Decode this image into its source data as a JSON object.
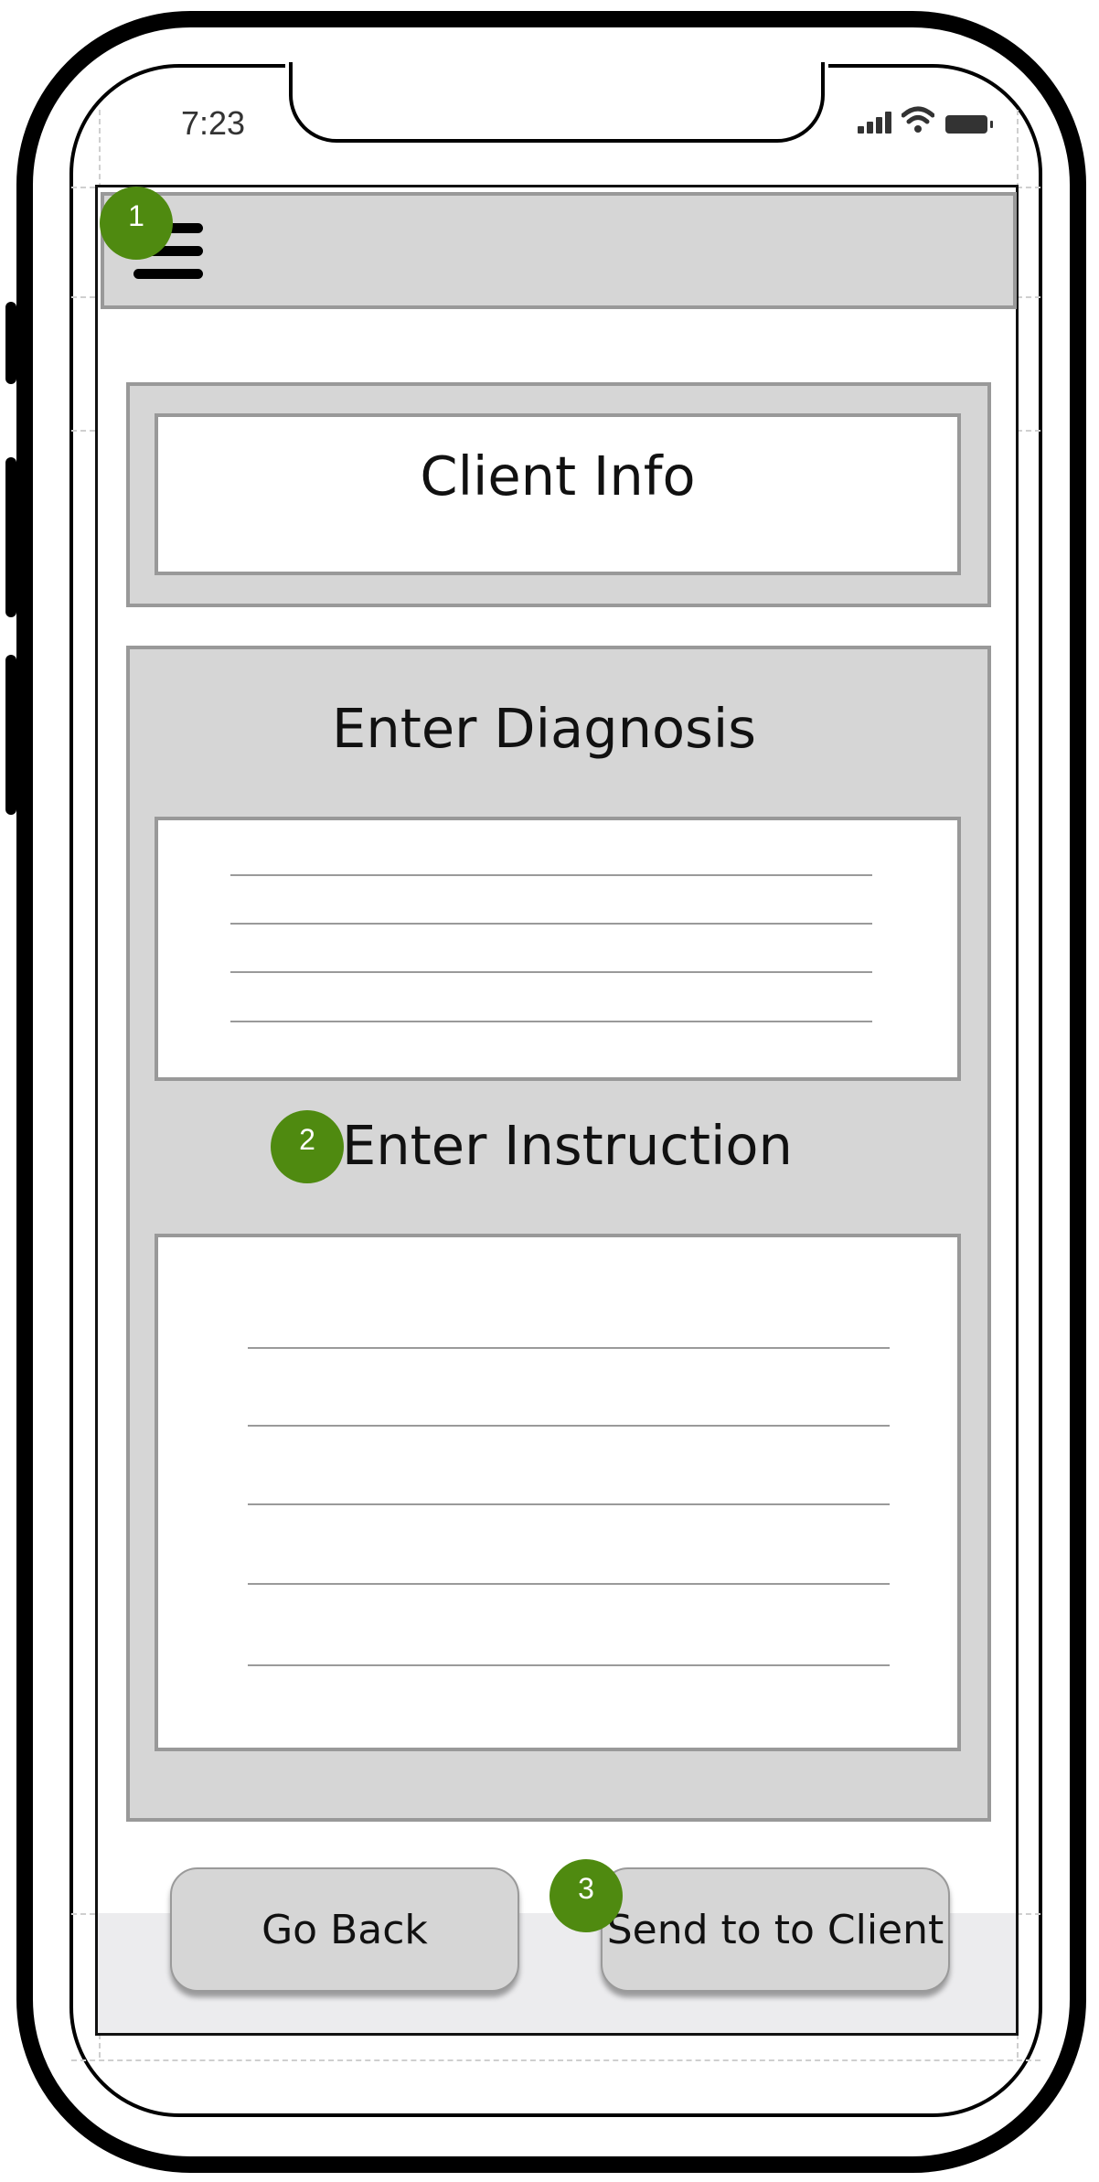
{
  "status_bar": {
    "time": "7:23"
  },
  "header": {
    "menu_icon": "hamburger-menu-icon"
  },
  "client_info": {
    "title": "Client Info"
  },
  "diagnosis": {
    "title": "Enter Diagnosis",
    "line_count": 4
  },
  "instruction": {
    "title": "Enter Instruction",
    "line_count": 5
  },
  "buttons": {
    "back_label": "Go Back",
    "send_label": "Send to to Client"
  },
  "annotations": [
    "1",
    "2",
    "3"
  ],
  "colors": {
    "marker": "#4f8a10",
    "panel": "#d6d6d6",
    "border": "#999999"
  }
}
